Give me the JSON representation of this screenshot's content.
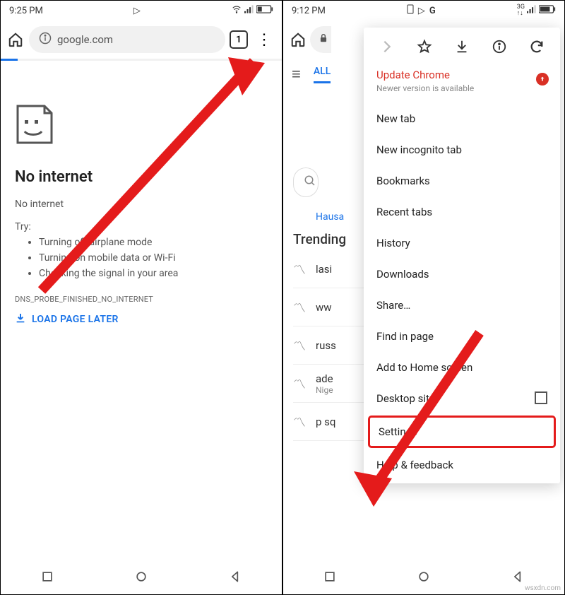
{
  "left": {
    "status_time": "9:25 PM",
    "omnibox_text": "google.com",
    "tab_count": "1",
    "error_heading": "No internet",
    "error_sub": "No internet",
    "try_label": "Try:",
    "tips": [
      "Turning off airplane mode",
      "Turning on mobile data or Wi-Fi",
      "Checking the signal in your area"
    ],
    "error_code": "DNS_PROBE_FINISHED_NO_INTERNET",
    "load_later": "LOAD PAGE LATER"
  },
  "right": {
    "status_time": "9:12 PM",
    "tab_all": "ALL",
    "lang": "Hausa",
    "trending_header": "Trending",
    "trending": [
      {
        "t": "lasi"
      },
      {
        "t": "ww"
      },
      {
        "t": "russ"
      },
      {
        "t": "ade",
        "s": "Nige"
      },
      {
        "t": "p sq"
      }
    ],
    "menu": {
      "update_title": "Update Chrome",
      "update_sub": "Newer version is available",
      "items": [
        "New tab",
        "New incognito tab",
        "Bookmarks",
        "Recent tabs",
        "History",
        "Downloads",
        "Share…",
        "Find in page",
        "Add to Home screen",
        "Desktop site",
        "Settings",
        "Help & feedback"
      ]
    }
  },
  "watermark": "wsxdn.com"
}
